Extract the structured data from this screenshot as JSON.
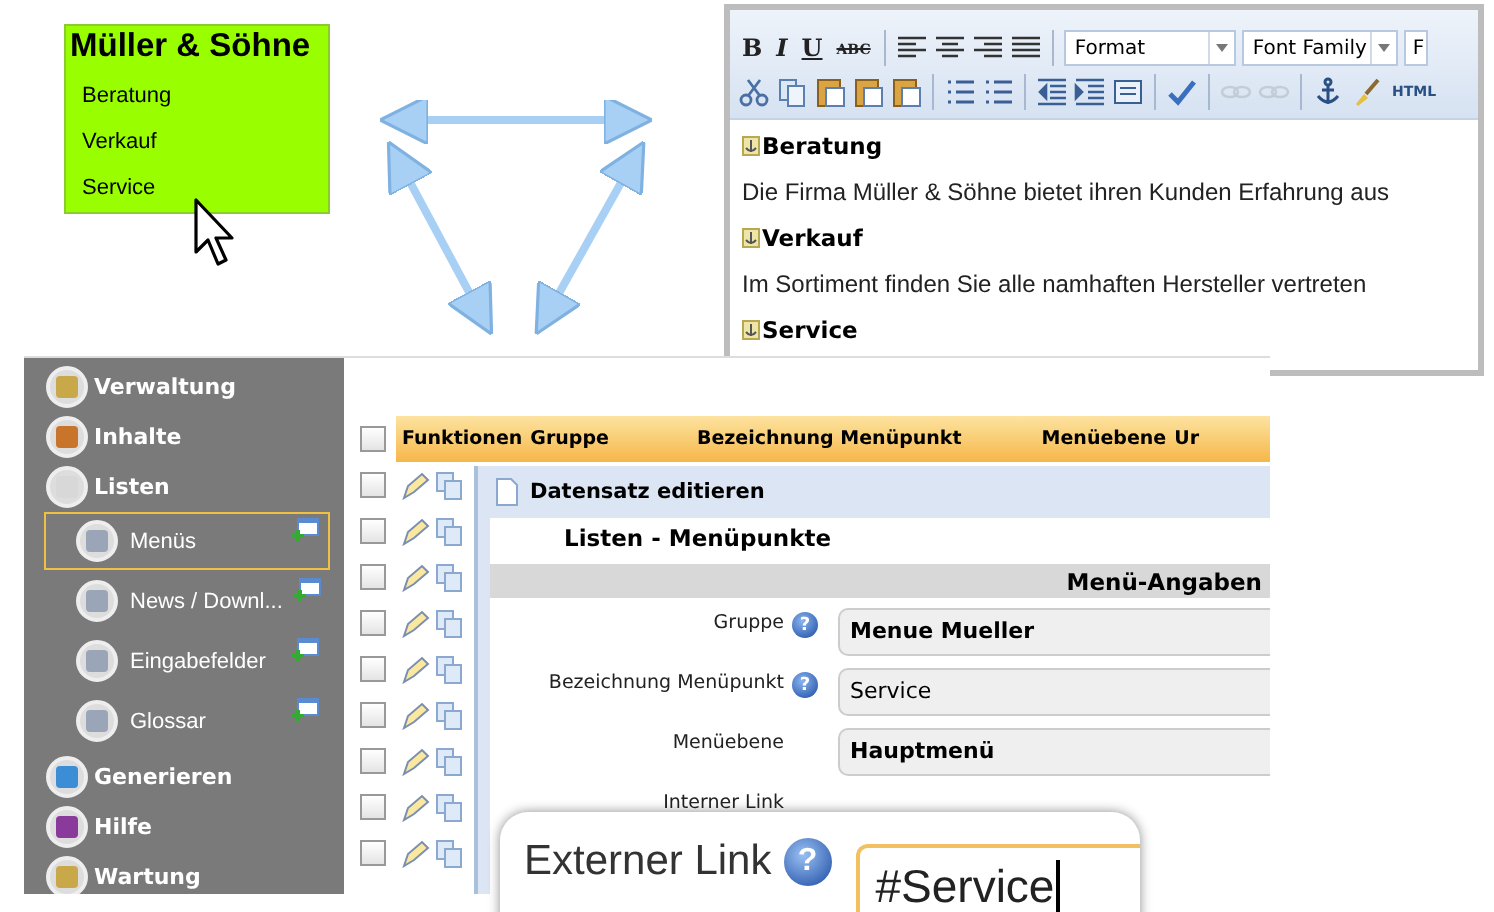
{
  "site_menu": {
    "title": "Müller & Söhne",
    "items": [
      {
        "label": "Beratung"
      },
      {
        "label": "Verkauf"
      },
      {
        "label": "Service"
      }
    ]
  },
  "editor": {
    "format_buttons": [
      "B",
      "I",
      "U",
      "ABC"
    ],
    "format_dropdown": "Format",
    "font_dropdown": "Font Family",
    "cut_dropdown": "F",
    "tools": [
      {
        "disabled": false
      },
      {
        "disabled": false
      },
      {
        "disabled": false
      },
      {
        "disabled": false
      },
      {
        "disabled": false
      },
      {
        "disabled": false
      },
      {
        "disabled": false
      },
      {
        "disabled": false
      },
      {
        "disabled": false
      },
      {
        "disabled": false
      },
      {
        "disabled": false
      },
      {
        "disabled": true
      },
      {
        "disabled": true
      },
      {
        "disabled": false
      },
      {
        "disabled": false
      },
      {
        "disabled": false,
        "label": "HTML"
      }
    ],
    "content": [
      {
        "kind": "heading",
        "text": "Beratung"
      },
      {
        "kind": "paragraph",
        "text": "Die Firma Müller & Söhne bietet ihren Kunden Erfahrung aus"
      },
      {
        "kind": "heading",
        "text": "Verkauf"
      },
      {
        "kind": "paragraph",
        "text": "Im Sortiment finden Sie alle namhaften Hersteller vertreten"
      },
      {
        "kind": "heading",
        "text": "Service"
      }
    ]
  },
  "admin": {
    "sidebar": [
      {
        "label": "Verwaltung",
        "selected": false
      },
      {
        "label": "Inhalte",
        "selected": false
      },
      {
        "label": "Listen",
        "selected": false,
        "children": [
          {
            "label": "Menüs",
            "selected": true
          },
          {
            "label": "News / Downl...",
            "selected": false
          },
          {
            "label": "Eingabefelder",
            "selected": false
          },
          {
            "label": "Glossar",
            "selected": false
          }
        ]
      },
      {
        "label": "Generieren",
        "selected": false
      },
      {
        "label": "Hilfe",
        "selected": false
      },
      {
        "label": "Wartung",
        "selected": false
      }
    ],
    "columns": [
      "Funktionen",
      "Gruppe",
      "Bezeichnung Menüpunkt",
      "Menüebene",
      "Ur"
    ],
    "header_checked": false,
    "rows": [
      {
        "checked": false
      },
      {
        "checked": false
      },
      {
        "checked": false
      },
      {
        "checked": false
      },
      {
        "checked": false
      },
      {
        "checked": false
      },
      {
        "checked": false
      },
      {
        "checked": false
      },
      {
        "checked": false
      }
    ],
    "dialog": {
      "title": "Datensatz editieren",
      "heading": "Listen - Menüpunkte",
      "section": "Menü-Angaben",
      "fields": [
        {
          "label": "Gruppe",
          "help": "?",
          "value": "Menue Mueller",
          "bold": true
        },
        {
          "label": "Bezeichnung Menüpunkt",
          "help": "?",
          "value": "Service",
          "bold": false
        },
        {
          "label": "Menüebene",
          "value": "Hauptmenü",
          "bold": true
        }
      ],
      "partial_label": "Interner Link"
    }
  },
  "magnifier": {
    "label": "Externer Link",
    "help": "?",
    "value": "#Service"
  }
}
